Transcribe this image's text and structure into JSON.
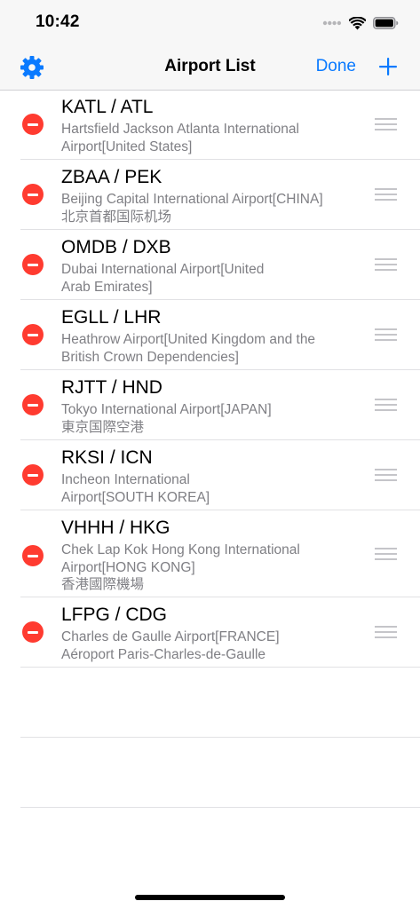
{
  "status_bar": {
    "time": "10:42",
    "icons": [
      "cellular-dots-icon",
      "wifi-icon",
      "battery-icon"
    ]
  },
  "nav": {
    "title": "Airport List",
    "done_label": "Done",
    "left_icon": "gear-icon",
    "right_icon": "plus-icon",
    "accent_color": "#0a7aff"
  },
  "airports": [
    {
      "code": "KATL / ATL",
      "lines": [
        "Hartsfield Jackson Atlanta International",
        "Airport[United States]"
      ]
    },
    {
      "code": "ZBAA / PEK",
      "lines": [
        "Beijing Capital International Airport[CHINA]",
        "北京首都国际机场"
      ]
    },
    {
      "code": "OMDB / DXB",
      "lines": [
        "Dubai International Airport[United",
        "Arab Emirates]"
      ]
    },
    {
      "code": "EGLL / LHR",
      "lines": [
        "Heathrow Airport[United Kingdom and the",
        "British Crown Dependencies]"
      ]
    },
    {
      "code": "RJTT / HND",
      "lines": [
        "Tokyo International Airport[JAPAN]",
        "東京国際空港"
      ]
    },
    {
      "code": "RKSI / ICN",
      "lines": [
        "Incheon International",
        "Airport[SOUTH KOREA]"
      ]
    },
    {
      "code": "VHHH / HKG",
      "lines": [
        "Chek Lap Kok Hong Kong International",
        "Airport[HONG KONG]",
        "香港國際機場"
      ]
    },
    {
      "code": "LFPG / CDG",
      "lines": [
        "Charles de Gaulle Airport[FRANCE]",
        "Aéroport Paris-Charles-de-Gaulle"
      ]
    }
  ],
  "row_icons": {
    "delete": "minus-circle-icon",
    "reorder": "reorder-handle-icon",
    "delete_color": "#ff3b30"
  }
}
